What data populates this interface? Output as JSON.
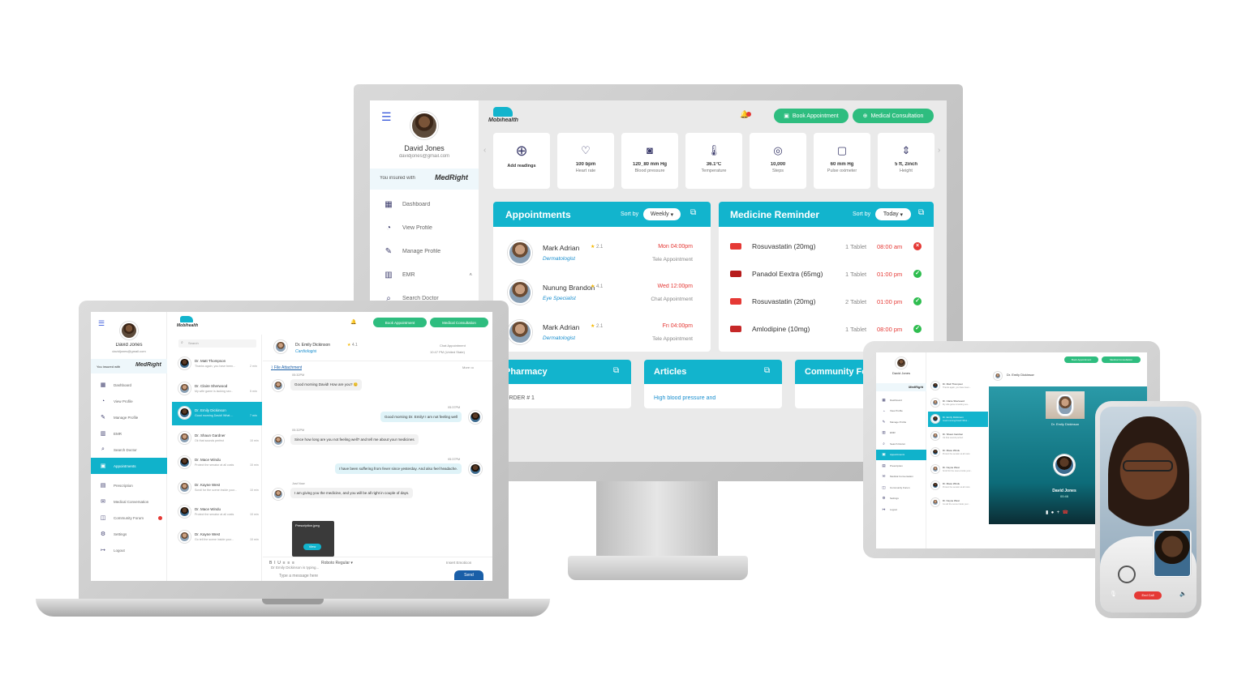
{
  "brand": {
    "app_name": "Mobihealth",
    "insurer": "MedRight",
    "insured_label": "You insured with"
  },
  "user": {
    "name": "David Jones",
    "email": "davidjones@gmail.com"
  },
  "colors": {
    "teal": "#12b4cd",
    "green": "#2ebd7f",
    "red": "#e53935"
  },
  "header": {
    "book_label": "Book Appointment",
    "consult_label": "Medical Consultation"
  },
  "sidebar": {
    "items": [
      "Dashboard",
      "View Profile",
      "Manage Profile",
      "EMR",
      "Search Doctor",
      "Appointments",
      "Prescription",
      "Medical Conversation",
      "Community Forum",
      "Settings",
      "Logout"
    ]
  },
  "vitals": [
    {
      "value": "",
      "label": "Add readings",
      "icon": "plus-circle-icon"
    },
    {
      "value": "100 bpm",
      "label": "Heart rate",
      "icon": "heart-rate-icon"
    },
    {
      "value": "120_80 mm Hg",
      "label": "Blood pressure",
      "icon": "blood-pressure-icon"
    },
    {
      "value": "36.1°C",
      "label": "Temperature",
      "icon": "thermometer-icon"
    },
    {
      "value": "10,000",
      "label": "Steps",
      "icon": "steps-icon"
    },
    {
      "value": "60 mm Hg",
      "label": "Pulse oximeter",
      "icon": "oximeter-icon"
    },
    {
      "value": "5 ft, 2inch",
      "label": "Height",
      "icon": "height-icon"
    }
  ],
  "appointments": {
    "title": "Appointments",
    "sort_label": "Sort by",
    "sort_value": "Weekly",
    "rows": [
      {
        "name": "Mark Adrian",
        "rating": "2.1",
        "specialty": "Dermatologist",
        "time": "Mon 04:00pm",
        "type": "Tele Appointment"
      },
      {
        "name": "Nunung Brandon",
        "rating": "4.1",
        "specialty": "Eye Specialist",
        "time": "Wed 12:00pm",
        "type": "Chat Appointment"
      },
      {
        "name": "Mark Adrian",
        "rating": "2.1",
        "specialty": "Dermatologist",
        "time": "Fri 04:00pm",
        "type": "Tele Appointment"
      }
    ]
  },
  "medicine": {
    "title": "Medicine Reminder",
    "sort_label": "Sort by",
    "sort_value": "Today",
    "rows": [
      {
        "name": "Rosuvastatin (20mg)",
        "dose": "1 Tablet",
        "time": "08:00 am",
        "status": "missed"
      },
      {
        "name": "Panadol Eextra (65mg)",
        "dose": "1 Tablet",
        "time": "01:00 pm",
        "status": "taken"
      },
      {
        "name": "Rosuvastatin (20mg)",
        "dose": "2 Tablet",
        "time": "01:00 pm",
        "status": "taken"
      },
      {
        "name": "Amlodipine (10mg)",
        "dose": "1 Tablet",
        "time": "08:00 pm",
        "status": "taken"
      }
    ]
  },
  "bottom_panels": [
    "Pharmacy",
    "Articles",
    "Community Fo"
  ],
  "bottom_snippets": {
    "pharmacy": "ORDER # 1",
    "articles": "High blood pressure and"
  },
  "chat": {
    "search_placeholder": "Search",
    "contacts": [
      {
        "name": "Dr. Matt Thompson",
        "preview": "Thanks again, you have been...",
        "time": "2 min"
      },
      {
        "name": "Dr. Claire Sherwood",
        "preview": "My wife game is lacking sev...",
        "time": "5 min"
      },
      {
        "name": "Dr. Emily Dickinson",
        "preview": "Good morning David! What ...",
        "time": "7 min"
      },
      {
        "name": "Dr. Shaun Gardner",
        "preview": "Ok that sounds perfect",
        "time": "10 min"
      },
      {
        "name": "Dr. Mace Windu",
        "preview": "Protect the senator at all costs",
        "time": "10 min"
      },
      {
        "name": "Dr. Kayne West",
        "preview": "Scroll for the scene inside your...",
        "time": "10 min"
      },
      {
        "name": "Dr. Mace Windu",
        "preview": "Protect the senator at all costs",
        "time": "10 min"
      },
      {
        "name": "Dr. Kayne West",
        "preview": "Go tell the scene inside your...",
        "time": "10 min"
      }
    ],
    "doctor": {
      "name": "Dr. Emily Dickinson",
      "rating": "4.1",
      "specialty": "Cardiologist",
      "appt_type": "Chat Appointment",
      "appt_time": "10:47 PM (United State)"
    },
    "file_attachment": "File Attachment",
    "more": "More",
    "messages": [
      {
        "side": "left",
        "time": "05:32PM",
        "text": "Good morning David! How are you? 😊"
      },
      {
        "side": "right",
        "time": "05:37PM",
        "text": "Good morning Dr. Emily! I am not feeling well"
      },
      {
        "side": "left",
        "time": "05:32PM",
        "text": "Since how long are you not feeling well? and tell me about your medicines"
      },
      {
        "side": "right",
        "time": "05:37PM",
        "text": "I have been suffering from fever since yesterday. And also feel headache."
      },
      {
        "side": "left",
        "time": "Just Now",
        "text": "I am giving you the medicine, and you will be all right in couple of days."
      }
    ],
    "attachment_label": "Prescription.jpeg",
    "attachment_btn": "View",
    "typing": "Dr Emily Dickinson is typing...",
    "font": "Roboto Regular",
    "insert_emoticon": "Insert Emoticon",
    "input_placeholder": "Type a message here",
    "send": "Send"
  },
  "video": {
    "doctor": "Dr. Emily Dickinson",
    "patient": "David Jones",
    "duration": "00:46",
    "end_call": "End Call"
  }
}
